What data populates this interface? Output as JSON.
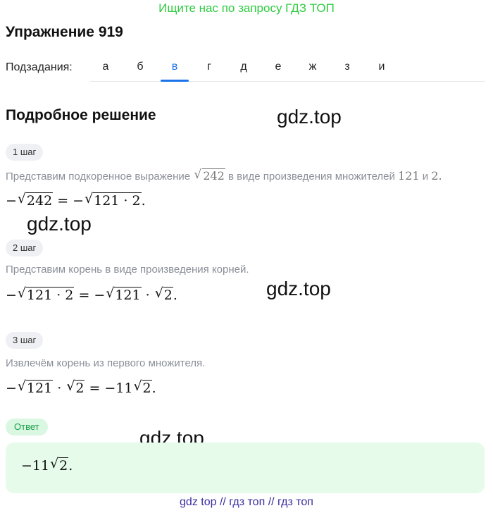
{
  "banner": "Ищите нас по запросу ГДЗ ТОП",
  "title": "Упражнение 919",
  "subtasks": {
    "label": "Подзадания:",
    "tabs": [
      "а",
      "б",
      "в",
      "г",
      "д",
      "е",
      "ж",
      "з",
      "и"
    ],
    "active": "в"
  },
  "section_title": "Подробное решение",
  "watermarks": [
    "gdz.top",
    "gdz.top",
    "gdz.top",
    "gdz.top"
  ],
  "steps": [
    {
      "badge": "1 шаг",
      "text_before": "Представим подкоренное выражение ",
      "text_radicand": "242",
      "text_middle": " в виде произведения множителей ",
      "text_num1": "121",
      "text_and": " и ",
      "text_num2": "2.",
      "formula": {
        "left_minus": "−",
        "left_rad": "242",
        "eq": " = −",
        "right_rad": "121 · 2",
        "end": "."
      }
    },
    {
      "badge": "2 шаг",
      "text": "Представим корень в виде произведения корней.",
      "formula": {
        "left_minus": "−",
        "left_rad": "121 · 2",
        "eq": " = −",
        "right_rad1": "121",
        "dot": " · ",
        "right_rad2": "2",
        "end": "."
      }
    },
    {
      "badge": "3 шаг",
      "text": "Извлечём корень из первого множителя.",
      "formula": {
        "left_minus": "−",
        "left_rad1": "121",
        "dot": " · ",
        "left_rad2": "2",
        "eq": " = −11",
        "right_rad": "2",
        "end": "."
      }
    }
  ],
  "answer": {
    "badge": "Ответ",
    "formula": {
      "prefix": "−11",
      "rad": "2",
      "end": "."
    }
  },
  "footer": "gdz top  //  гдз топ  //  гдз топ"
}
